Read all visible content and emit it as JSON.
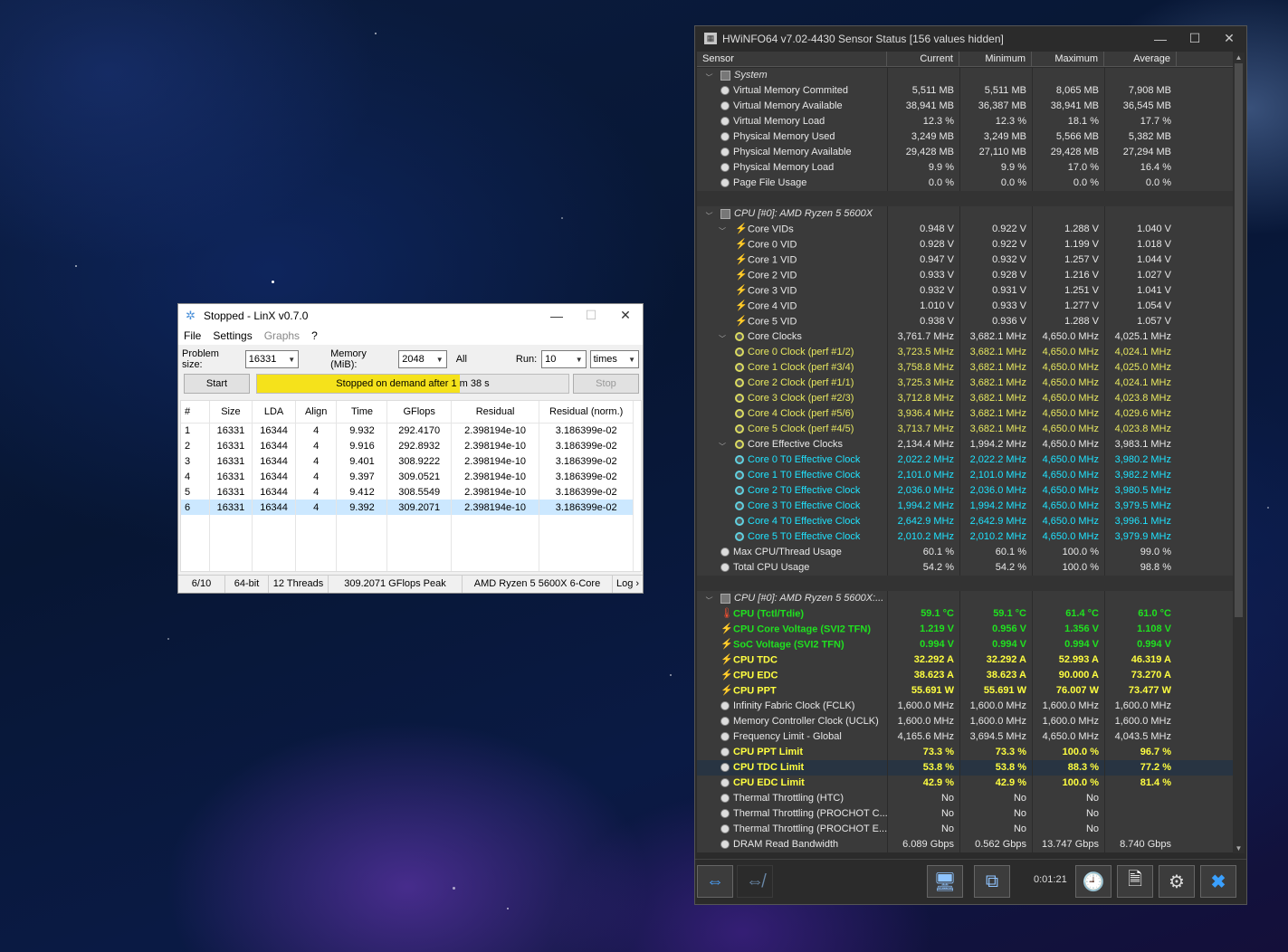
{
  "linx": {
    "title": "Stopped - LinX v0.7.0",
    "menu": [
      "File",
      "Settings",
      "Graphs",
      "?"
    ],
    "problem_size_label": "Problem size:",
    "problem_size_value": "16331",
    "memory_label": "Memory (MiB):",
    "memory_value": "2048",
    "all_label": "All",
    "run_label": "Run:",
    "run_value": "10",
    "run_unit": "times",
    "start_label": "Start",
    "stop_label": "Stop",
    "progress_text": "Stopped on demand after 1 m 38 s",
    "progress_fraction": 0.65,
    "columns": [
      "#",
      "Size",
      "LDA",
      "Align",
      "Time",
      "GFlops",
      "Residual",
      "Residual (norm.)"
    ],
    "rows": [
      [
        "1",
        "16331",
        "16344",
        "4",
        "9.932",
        "292.4170",
        "2.398194e-10",
        "3.186399e-02"
      ],
      [
        "2",
        "16331",
        "16344",
        "4",
        "9.916",
        "292.8932",
        "2.398194e-10",
        "3.186399e-02"
      ],
      [
        "3",
        "16331",
        "16344",
        "4",
        "9.401",
        "308.9222",
        "2.398194e-10",
        "3.186399e-02"
      ],
      [
        "4",
        "16331",
        "16344",
        "4",
        "9.397",
        "309.0521",
        "2.398194e-10",
        "3.186399e-02"
      ],
      [
        "5",
        "16331",
        "16344",
        "4",
        "9.412",
        "308.5549",
        "2.398194e-10",
        "3.186399e-02"
      ],
      [
        "6",
        "16331",
        "16344",
        "4",
        "9.392",
        "309.2071",
        "2.398194e-10",
        "3.186399e-02"
      ]
    ],
    "selected_row": 5,
    "status": [
      "6/10",
      "64-bit",
      "12 Threads",
      "309.2071 GFlops Peak",
      "AMD Ryzen 5 5600X 6-Core",
      "Log ›"
    ]
  },
  "hwinfo": {
    "title": "HWiNFO64 v7.02-4430 Sensor Status [156 values hidden]",
    "columns": [
      "Sensor",
      "Current",
      "Minimum",
      "Maximum",
      "Average"
    ],
    "timer": "0:01:21",
    "rows": [
      {
        "type": "section",
        "name": "System",
        "icon": "chip"
      },
      {
        "name": "Virtual Memory Commited",
        "icon": "circle",
        "v": [
          "5,511 MB",
          "5,511 MB",
          "8,065 MB",
          "7,908 MB"
        ]
      },
      {
        "name": "Virtual Memory Available",
        "icon": "circle",
        "v": [
          "38,941 MB",
          "36,387 MB",
          "38,941 MB",
          "36,545 MB"
        ]
      },
      {
        "name": "Virtual Memory Load",
        "icon": "circle",
        "v": [
          "12.3 %",
          "12.3 %",
          "18.1 %",
          "17.7 %"
        ]
      },
      {
        "name": "Physical Memory Used",
        "icon": "circle",
        "v": [
          "3,249 MB",
          "3,249 MB",
          "5,566 MB",
          "5,382 MB"
        ]
      },
      {
        "name": "Physical Memory Available",
        "icon": "circle",
        "v": [
          "29,428 MB",
          "27,110 MB",
          "29,428 MB",
          "27,294 MB"
        ]
      },
      {
        "name": "Physical Memory Load",
        "icon": "circle",
        "v": [
          "9.9 %",
          "9.9 %",
          "17.0 %",
          "16.4 %"
        ]
      },
      {
        "name": "Page File Usage",
        "icon": "circle",
        "v": [
          "0.0 %",
          "0.0 %",
          "0.0 %",
          "0.0 %"
        ]
      },
      {
        "type": "blank"
      },
      {
        "type": "section",
        "name": "CPU [#0]: AMD Ryzen 5 5600X",
        "icon": "chip"
      },
      {
        "name": "Core VIDs",
        "icon": "bolt",
        "group": true,
        "v": [
          "0.948 V",
          "0.922 V",
          "1.288 V",
          "1.040 V"
        ]
      },
      {
        "name": "Core 0 VID",
        "icon": "bolt",
        "sub": true,
        "v": [
          "0.928 V",
          "0.922 V",
          "1.199 V",
          "1.018 V"
        ]
      },
      {
        "name": "Core 1 VID",
        "icon": "bolt",
        "sub": true,
        "v": [
          "0.947 V",
          "0.932 V",
          "1.257 V",
          "1.044 V"
        ]
      },
      {
        "name": "Core 2 VID",
        "icon": "bolt",
        "sub": true,
        "v": [
          "0.933 V",
          "0.928 V",
          "1.216 V",
          "1.027 V"
        ]
      },
      {
        "name": "Core 3 VID",
        "icon": "bolt",
        "sub": true,
        "v": [
          "0.932 V",
          "0.931 V",
          "1.251 V",
          "1.041 V"
        ]
      },
      {
        "name": "Core 4 VID",
        "icon": "bolt",
        "sub": true,
        "v": [
          "1.010 V",
          "0.933 V",
          "1.277 V",
          "1.054 V"
        ]
      },
      {
        "name": "Core 5 VID",
        "icon": "bolt",
        "sub": true,
        "v": [
          "0.938 V",
          "0.936 V",
          "1.288 V",
          "1.057 V"
        ]
      },
      {
        "name": "Core Clocks",
        "icon": "clock",
        "group": true,
        "v": [
          "3,761.7 MHz",
          "3,682.1 MHz",
          "4,650.0 MHz",
          "4,025.1 MHz"
        ]
      },
      {
        "name": "Core 0 Clock (perf #1/2)",
        "icon": "clock",
        "sub": true,
        "color": "yellowlight",
        "v": [
          "3,723.5 MHz",
          "3,682.1 MHz",
          "4,650.0 MHz",
          "4,024.1 MHz"
        ]
      },
      {
        "name": "Core 1 Clock (perf #3/4)",
        "icon": "clock",
        "sub": true,
        "color": "yellowlight",
        "v": [
          "3,758.8 MHz",
          "3,682.1 MHz",
          "4,650.0 MHz",
          "4,025.0 MHz"
        ]
      },
      {
        "name": "Core 2 Clock (perf #1/1)",
        "icon": "clock",
        "sub": true,
        "color": "yellowlight",
        "v": [
          "3,725.3 MHz",
          "3,682.1 MHz",
          "4,650.0 MHz",
          "4,024.1 MHz"
        ]
      },
      {
        "name": "Core 3 Clock (perf #2/3)",
        "icon": "clock",
        "sub": true,
        "color": "yellowlight",
        "v": [
          "3,712.8 MHz",
          "3,682.1 MHz",
          "4,650.0 MHz",
          "4,023.8 MHz"
        ]
      },
      {
        "name": "Core 4 Clock (perf #5/6)",
        "icon": "clock",
        "sub": true,
        "color": "yellowlight",
        "v": [
          "3,936.4 MHz",
          "3,682.1 MHz",
          "4,650.0 MHz",
          "4,029.6 MHz"
        ]
      },
      {
        "name": "Core 5 Clock (perf #4/5)",
        "icon": "clock",
        "sub": true,
        "color": "yellowlight",
        "v": [
          "3,713.7 MHz",
          "3,682.1 MHz",
          "4,650.0 MHz",
          "4,023.8 MHz"
        ]
      },
      {
        "name": "Core Effective Clocks",
        "icon": "clock",
        "group": true,
        "v": [
          "2,134.4 MHz",
          "1,994.2 MHz",
          "4,650.0 MHz",
          "3,983.1 MHz"
        ]
      },
      {
        "name": "Core 0 T0 Effective Clock",
        "icon": "clockeff",
        "sub": true,
        "color": "cyan",
        "v": [
          "2,022.2 MHz",
          "2,022.2 MHz",
          "4,650.0 MHz",
          "3,980.2 MHz"
        ]
      },
      {
        "name": "Core 1 T0 Effective Clock",
        "icon": "clockeff",
        "sub": true,
        "color": "cyan",
        "v": [
          "2,101.0 MHz",
          "2,101.0 MHz",
          "4,650.0 MHz",
          "3,982.2 MHz"
        ]
      },
      {
        "name": "Core 2 T0 Effective Clock",
        "icon": "clockeff",
        "sub": true,
        "color": "cyan",
        "v": [
          "2,036.0 MHz",
          "2,036.0 MHz",
          "4,650.0 MHz",
          "3,980.5 MHz"
        ]
      },
      {
        "name": "Core 3 T0 Effective Clock",
        "icon": "clockeff",
        "sub": true,
        "color": "cyan",
        "v": [
          "1,994.2 MHz",
          "1,994.2 MHz",
          "4,650.0 MHz",
          "3,979.5 MHz"
        ]
      },
      {
        "name": "Core 4 T0 Effective Clock",
        "icon": "clockeff",
        "sub": true,
        "color": "cyan",
        "v": [
          "2,642.9 MHz",
          "2,642.9 MHz",
          "4,650.0 MHz",
          "3,996.1 MHz"
        ]
      },
      {
        "name": "Core 5 T0 Effective Clock",
        "icon": "clockeff",
        "sub": true,
        "color": "cyan",
        "v": [
          "2,010.2 MHz",
          "2,010.2 MHz",
          "4,650.0 MHz",
          "3,979.9 MHz"
        ]
      },
      {
        "name": "Max CPU/Thread Usage",
        "icon": "circle",
        "v": [
          "60.1 %",
          "60.1 %",
          "100.0 %",
          "99.0 %"
        ]
      },
      {
        "name": "Total CPU Usage",
        "icon": "circle",
        "v": [
          "54.2 %",
          "54.2 %",
          "100.0 %",
          "98.8 %"
        ]
      },
      {
        "type": "blank"
      },
      {
        "type": "section",
        "name": "CPU [#0]: AMD Ryzen 5 5600X:...",
        "icon": "chip"
      },
      {
        "name": "CPU (Tctl/Tdie)",
        "icon": "therm",
        "color": "green",
        "v": [
          "59.1 °C",
          "59.1 °C",
          "61.4 °C",
          "61.0 °C"
        ]
      },
      {
        "name": "CPU Core Voltage (SVI2 TFN)",
        "icon": "bolt",
        "color": "green",
        "v": [
          "1.219 V",
          "0.956 V",
          "1.356 V",
          "1.108 V"
        ]
      },
      {
        "name": "SoC Voltage (SVI2 TFN)",
        "icon": "bolt",
        "color": "green",
        "v": [
          "0.994 V",
          "0.994 V",
          "0.994 V",
          "0.994 V"
        ]
      },
      {
        "name": "CPU TDC",
        "icon": "bolt",
        "color": "yellow",
        "v": [
          "32.292 A",
          "32.292 A",
          "52.993 A",
          "46.319 A"
        ]
      },
      {
        "name": "CPU EDC",
        "icon": "bolt",
        "color": "yellow",
        "v": [
          "38.623 A",
          "38.623 A",
          "90.000 A",
          "73.270 A"
        ]
      },
      {
        "name": "CPU PPT",
        "icon": "bolt",
        "color": "yellow",
        "v": [
          "55.691 W",
          "55.691 W",
          "76.007 W",
          "73.477 W"
        ]
      },
      {
        "name": "Infinity Fabric Clock (FCLK)",
        "icon": "circle",
        "v": [
          "1,600.0 MHz",
          "1,600.0 MHz",
          "1,600.0 MHz",
          "1,600.0 MHz"
        ]
      },
      {
        "name": "Memory Controller Clock (UCLK)",
        "icon": "circle",
        "v": [
          "1,600.0 MHz",
          "1,600.0 MHz",
          "1,600.0 MHz",
          "1,600.0 MHz"
        ]
      },
      {
        "name": "Frequency Limit - Global",
        "icon": "circle",
        "v": [
          "4,165.6 MHz",
          "3,694.5 MHz",
          "4,650.0 MHz",
          "4,043.5 MHz"
        ]
      },
      {
        "name": "CPU PPT Limit",
        "icon": "circle",
        "color": "yellow",
        "v": [
          "73.3 %",
          "73.3 %",
          "100.0 %",
          "96.7 %"
        ]
      },
      {
        "name": "CPU TDC Limit",
        "icon": "circle",
        "color": "yellow",
        "highlight": true,
        "v": [
          "53.8 %",
          "53.8 %",
          "88.3 %",
          "77.2 %"
        ]
      },
      {
        "name": "CPU EDC Limit",
        "icon": "circle",
        "color": "yellow",
        "v": [
          "42.9 %",
          "42.9 %",
          "100.0 %",
          "81.4 %"
        ]
      },
      {
        "name": "Thermal Throttling (HTC)",
        "icon": "circle",
        "v": [
          "No",
          "No",
          "No",
          ""
        ]
      },
      {
        "name": "Thermal Throttling (PROCHOT C...",
        "icon": "circle",
        "v": [
          "No",
          "No",
          "No",
          ""
        ]
      },
      {
        "name": "Thermal Throttling (PROCHOT E...",
        "icon": "circle",
        "v": [
          "No",
          "No",
          "No",
          ""
        ]
      },
      {
        "name": "DRAM Read Bandwidth",
        "icon": "circle",
        "v": [
          "6.089 Gbps",
          "0.562 Gbps",
          "13.747 Gbps",
          "8.740 Gbps"
        ]
      }
    ]
  }
}
